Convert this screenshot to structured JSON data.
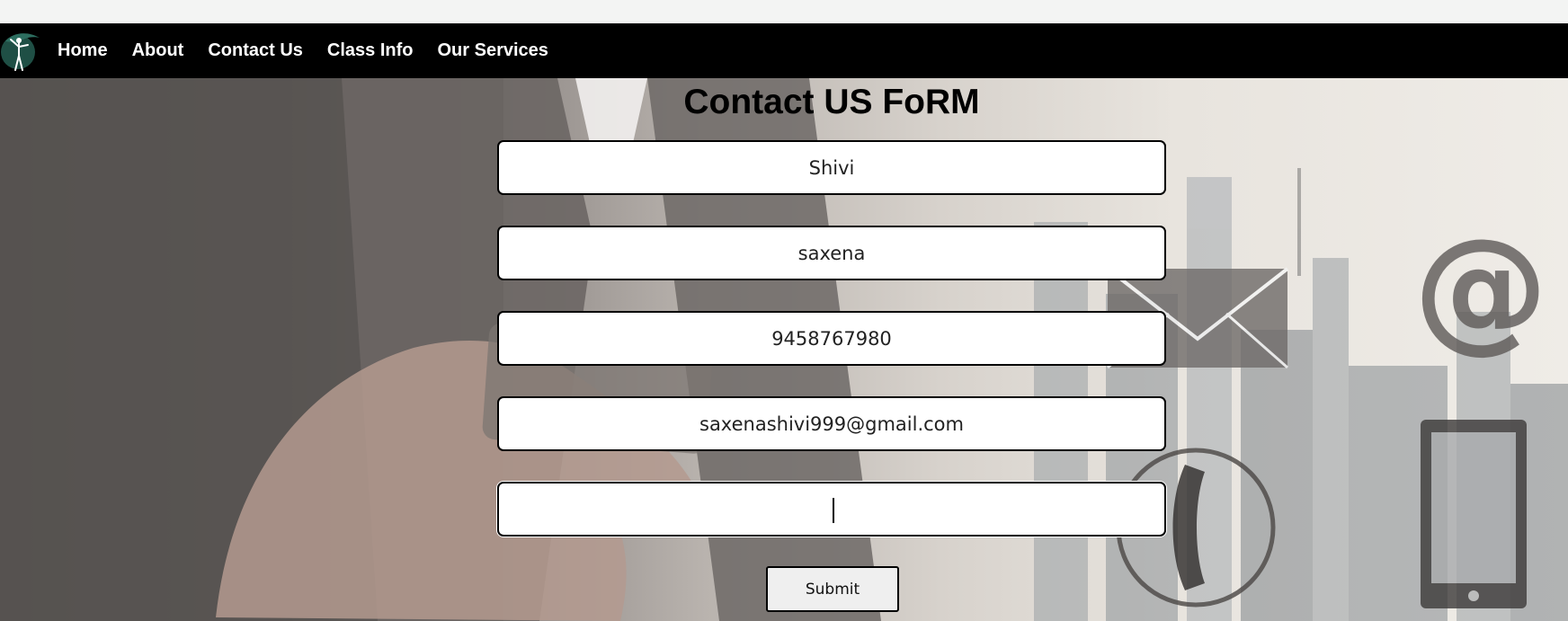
{
  "nav": {
    "logo_name": "dancer-logo",
    "links": [
      "Home",
      "About",
      "Contact Us",
      "Class Info",
      "Our Services"
    ]
  },
  "form": {
    "title": "Contact US FoRM",
    "fields": [
      {
        "name": "first-name-field",
        "value": "Shivi"
      },
      {
        "name": "last-name-field",
        "value": "saxena"
      },
      {
        "name": "phone-field",
        "value": "9458767980"
      },
      {
        "name": "email-field",
        "value": "saxenashivi999@gmail.com"
      },
      {
        "name": "message-field",
        "value": ""
      }
    ],
    "submit_label": "Submit"
  },
  "background": {
    "icons": [
      "envelope-icon",
      "at-sign-icon",
      "telephone-icon",
      "tablet-icon"
    ]
  },
  "colors": {
    "navbar": "#000000",
    "nav_text": "#ffffff",
    "field_border": "#000000",
    "field_bg": "#ffffff"
  }
}
